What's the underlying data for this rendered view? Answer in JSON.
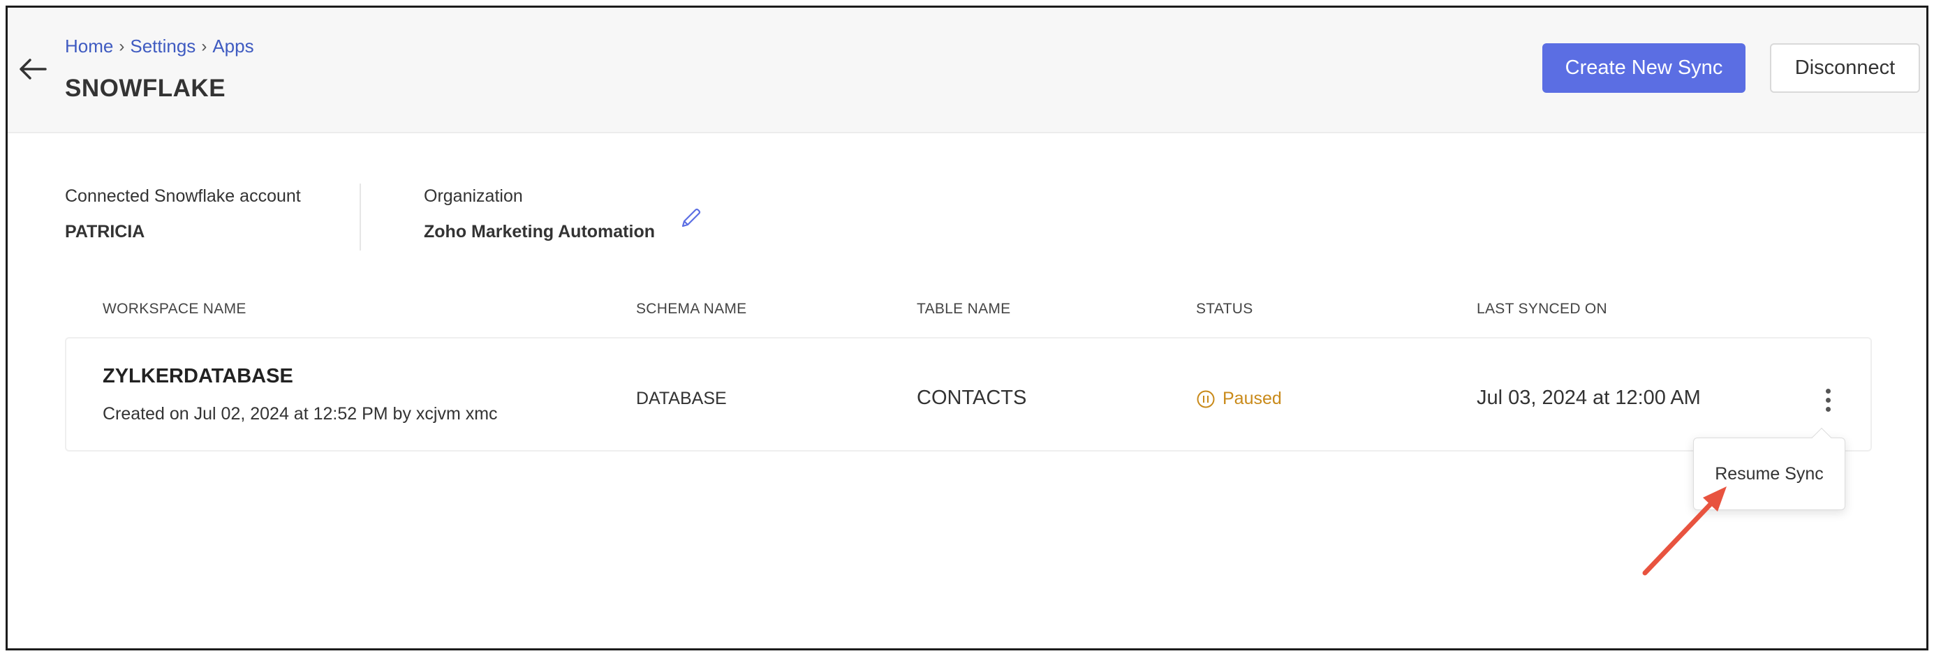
{
  "header": {
    "breadcrumb": [
      "Home",
      "Settings",
      "Apps"
    ],
    "breadcrumb_separator": "›",
    "title": "SNOWFLAKE",
    "create_button": "Create New Sync",
    "disconnect_button": "Disconnect"
  },
  "account": {
    "label": "Connected Snowflake account",
    "value": "PATRICIA"
  },
  "organization": {
    "label": "Organization",
    "value": "Zoho Marketing Automation"
  },
  "table": {
    "columns": [
      "WORKSPACE NAME",
      "SCHEMA NAME",
      "TABLE NAME",
      "STATUS",
      "LAST SYNCED ON"
    ],
    "rows": [
      {
        "workspace": "ZYLKERDATABASE",
        "created": "Created on Jul 02, 2024 at 12:52 PM by xcjvm xmc",
        "schema": "DATABASE",
        "table": "CONTACTS",
        "status": "Paused",
        "last_synced": "Jul 03, 2024 at 12:00 AM"
      }
    ]
  },
  "menu": {
    "items": [
      "Resume Sync"
    ]
  },
  "colors": {
    "primary": "#5b6ee3",
    "link": "#3f5bc1",
    "paused": "#c98a1a",
    "annotation_arrow": "#e8533f"
  },
  "icons": [
    "back-arrow-icon",
    "edit-pencil-icon",
    "pause-circle-icon",
    "kebab-menu-icon"
  ]
}
